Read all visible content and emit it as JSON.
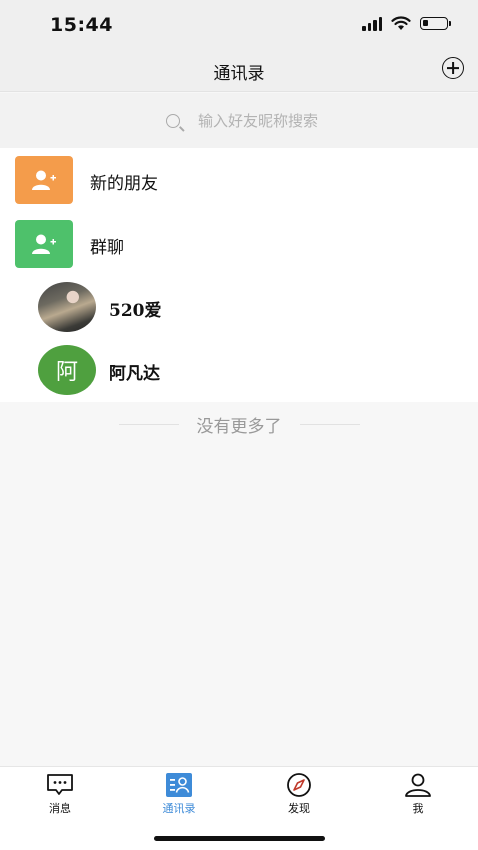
{
  "status_bar": {
    "time": "15:44"
  },
  "header": {
    "title": "通讯录"
  },
  "search": {
    "placeholder": "输入好友昵称搜索"
  },
  "special_items": [
    {
      "label": "新的朋友",
      "color": "#f49c4b"
    },
    {
      "label": "群聊",
      "color": "#4ec16b"
    }
  ],
  "contacts": [
    {
      "name": "520爱"
    },
    {
      "name": "阿凡达",
      "avatar_text": "阿",
      "avatar_color": "#4fa03f"
    }
  ],
  "list_end_text": "没有更多了",
  "tabs": [
    {
      "label": "消息",
      "icon": "message-icon"
    },
    {
      "label": "通讯录",
      "icon": "contacts-icon",
      "active": true
    },
    {
      "label": "发现",
      "icon": "compass-icon"
    },
    {
      "label": "我",
      "icon": "profile-icon"
    }
  ],
  "colors": {
    "accent": "#3e8bd8"
  }
}
